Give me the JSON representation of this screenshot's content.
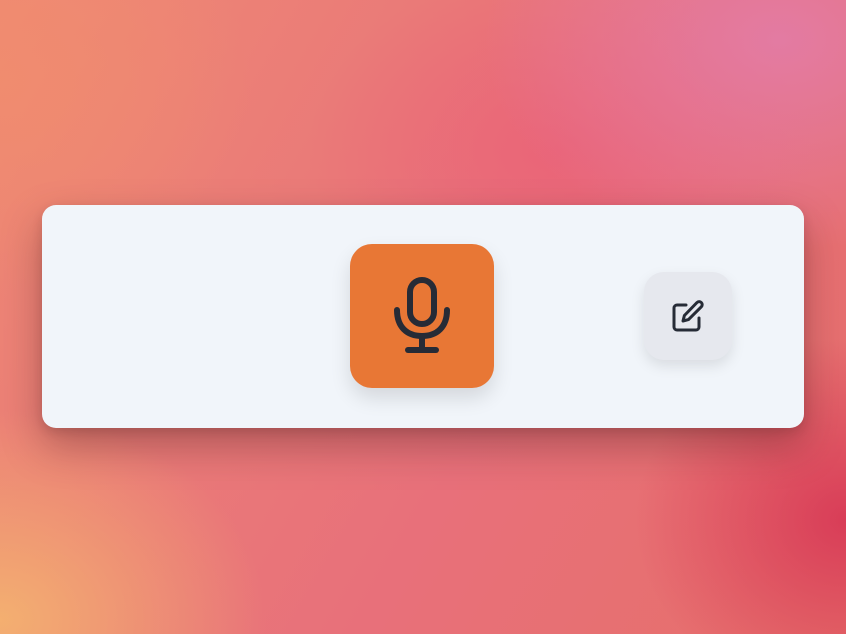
{
  "toolbar": {
    "background": "#f1f5fa",
    "mic_button": {
      "icon": "microphone-icon",
      "color": "#e87735",
      "icon_color": "#262b36"
    },
    "edit_button": {
      "icon": "edit-icon",
      "color": "#e6e8ee",
      "icon_color": "#262b36"
    }
  }
}
